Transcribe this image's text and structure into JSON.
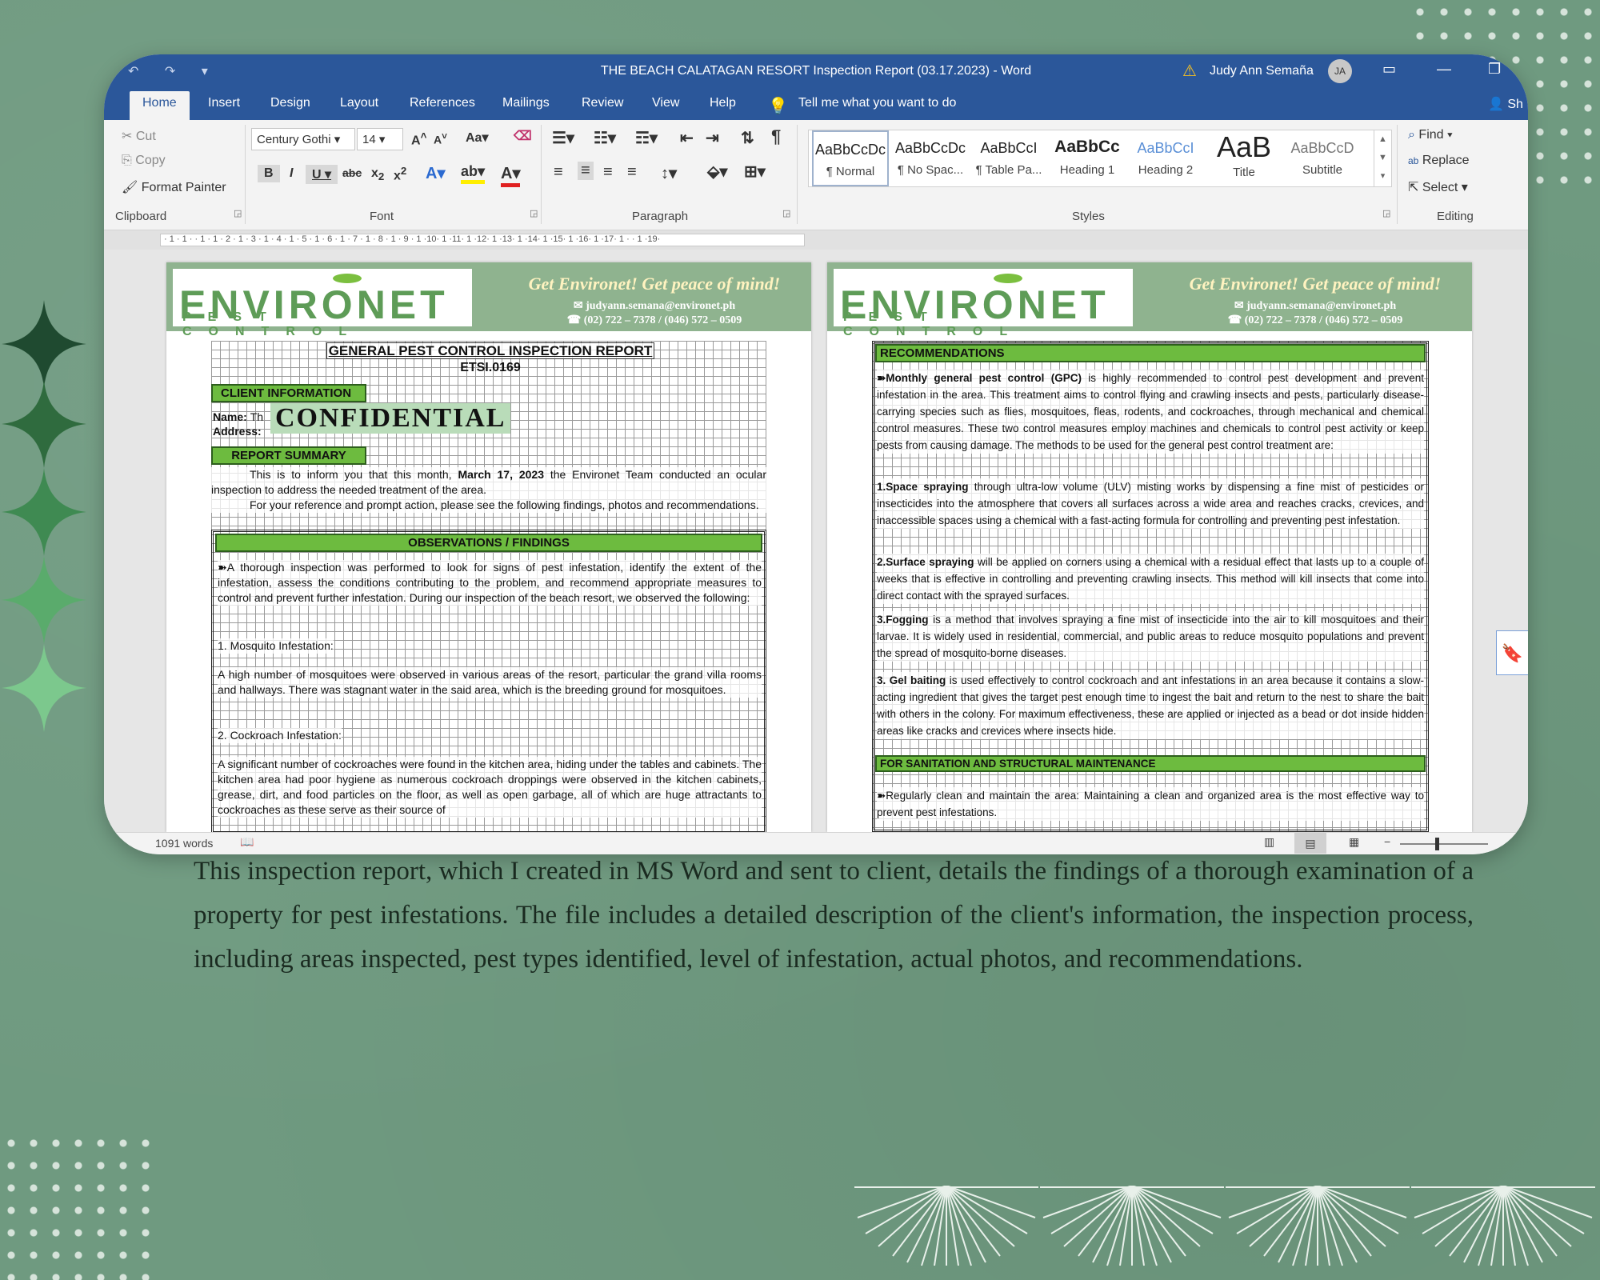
{
  "window": {
    "title": "THE BEACH CALATAGAN RESORT Inspection Report (03.17.2023)  -  Word",
    "user": "Judy Ann Semaña",
    "avatar": "JA",
    "qat": "↶ ↷ ▾"
  },
  "tabs": [
    "Home",
    "Insert",
    "Design",
    "Layout",
    "References",
    "Mailings",
    "Review",
    "View",
    "Help"
  ],
  "tellme": "Tell me what you want to do",
  "share": "Sh",
  "ribbon": {
    "clipboard": {
      "cut": "Cut",
      "copy": "Copy",
      "format_painter": "Format Painter",
      "label": "Clipboard"
    },
    "font": {
      "family": "Century Gothi",
      "size": "14",
      "label": "Font"
    },
    "paragraph": {
      "label": "Paragraph"
    },
    "styles": {
      "label": "Styles",
      "items": [
        {
          "preview": "AaBbCcDc",
          "name": "¶ Normal"
        },
        {
          "preview": "AaBbCcDc",
          "name": "¶ No Spac..."
        },
        {
          "preview": "AaBbCcI",
          "name": "¶ Table Pa..."
        },
        {
          "preview": "AaBbCc",
          "name": "Heading 1"
        },
        {
          "preview": "AaBbCcI",
          "name": "Heading 2"
        },
        {
          "preview": "AaB",
          "name": "Title"
        },
        {
          "preview": "AaBbCcD",
          "name": "Subtitle"
        }
      ]
    },
    "editing": {
      "find": "Find",
      "replace": "Replace",
      "select": "Select",
      "label": "Editing"
    }
  },
  "ruler": "· 1 · 1 ·  · 1 · 1 · 2 · 1 · 3 · 1 · 4 · 1 · 5 · 1 · 6 · 1 · 7 · 1 · 8 · 1 · 9 · 1 ·10· 1 ·11· 1 ·12· 1 ·13· 1 ·14· 1 ·15· 1 ·16· 1 ·17· 1 ·  · 1 ·19·",
  "header": {
    "logo_main": "ENVIRONET",
    "logo_sub": "PEST CONTROL",
    "slogan": "Get Environet! Get peace of mind!",
    "email": "✉ judyann.semana@environet.ph",
    "phone": "☎ (02) 722 – 7378 / (046) 572 – 0509"
  },
  "page1": {
    "title": "GENERAL PEST CONTROL INSPECTION REPORT",
    "code": "ETSI.0169",
    "client_info": "CLIENT INFORMATION",
    "name_label": "Name:",
    "name_value": "Th",
    "address_label": "Address:",
    "confidential": "CONFIDENTIAL",
    "report_summary": "REPORT SUMMARY",
    "summary1_a": "This is to inform you that this month, ",
    "summary1_b": "March 17, 2023",
    "summary1_c": " the Environet Team conducted an ocular inspection to address the needed treatment of the area.",
    "summary2": "For your reference and prompt action, please see the following findings, photos and recommendations.",
    "obs_header": "OBSERVATIONS / FINDINGS",
    "obs_intro": "➽A thorough inspection was performed to look for signs of pest infestation, identify the extent of the infestation, assess the conditions contributing to the problem, and recommend appropriate measures to control and prevent further infestation. During our inspection of the beach resort, we observed the following:",
    "obs1_title": "1. Mosquito Infestation:",
    "obs1_text": "A high number of mosquitoes were observed in various areas of the resort, particular the grand villa rooms and hallways. There was stagnant water in the said area, which is the breeding ground for mosquitoes.",
    "obs2_title": "2. Cockroach Infestation:",
    "obs2_text": "A significant number of cockroaches were found in the kitchen area, hiding under the tables and cabinets. The kitchen area had poor hygiene as numerous cockroach droppings were observed in the kitchen cabinets, grease, dirt, and food particles on the floor, as well as open garbage, all of which are huge attractants to cockroaches as these serve as their source of"
  },
  "page2": {
    "rec_header": "RECOMMENDATIONS",
    "gpc_b": "➽Monthly general pest control (GPC)",
    "gpc_t": " is highly recommended to control pest development and prevent infestation in the area. This treatment aims to control flying and crawling insects and pests, particularly disease-carrying species such as flies, mosquitoes, fleas, rodents, and cockroaches, through mechanical and chemical control measures. These two control measures employ machines and chemicals to control pest activity or keep pests from causing damage. The methods to be used for the general pest control treatment are:",
    "m1_b": "1.Space spraying",
    "m1_t": " through ultra-low volume (ULV) misting works by dispensing a fine mist of pesticides or insecticides into the atmosphere that covers all surfaces across a wide area and reaches cracks, crevices, and inaccessible spaces using a chemical with a fast-acting formula for controlling and preventing pest infestation.",
    "m2_b": "2.Surface spraying",
    "m2_t": " will be applied on corners using a chemical with a residual effect that lasts up to a couple of weeks that is effective in controlling and preventing crawling insects. This method will kill insects that come into direct contact with the sprayed surfaces.",
    "m3_b": "3.Fogging",
    "m3_t": " is a method that involves spraying a fine mist of insecticide into the air to kill mosquitoes and their larvae. It is widely used in residential, commercial, and public areas to reduce mosquito populations and prevent the spread of mosquito-borne diseases.",
    "m4_b": "3. Gel baiting",
    "m4_t": " is used effectively to control cockroach and ant infestations in an area because it contains a slow-acting ingredient that gives the target pest enough time to ingest the bait and return to the nest to share the bait with others in the colony. For maximum effectiveness, these are applied or injected as a bead or dot inside hidden areas like cracks and crevices where insects hide.",
    "san_header": "FOR SANITATION AND STRUCTURAL MAINTENANCE",
    "san_text": "➽Regularly clean and maintain the area: Maintaining a clean and organized area is the most effective way to prevent pest infestations."
  },
  "status": {
    "words": "1091 words"
  },
  "caption": "This inspection report, which I created in MS Word and sent to client, details the findings of a thorough examination of a property for pest infestations. The file includes a detailed description of the client's information, the inspection process, including areas inspected, pest types identified, level of infestation, actual photos, and recommendations."
}
